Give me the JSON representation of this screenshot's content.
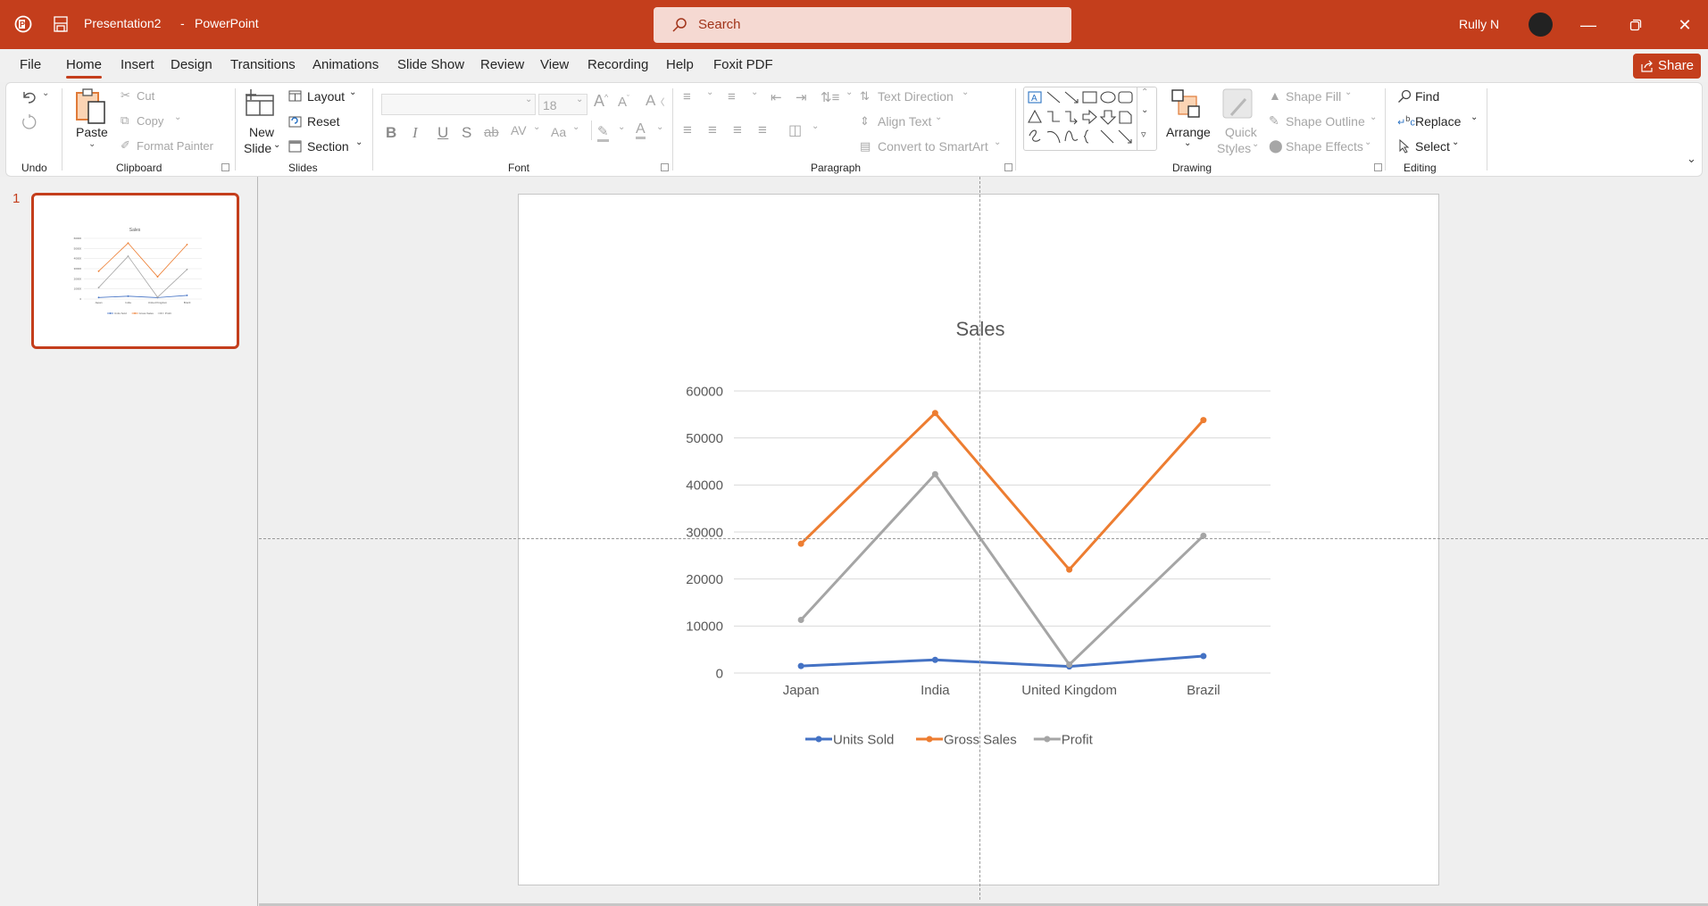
{
  "app": {
    "document_title": "Presentation2",
    "separator": "-",
    "app_name": "PowerPoint",
    "search_placeholder": "Search",
    "user_name": "Rully N",
    "accent_color": "#c43e1c"
  },
  "tabs": [
    {
      "label": "File",
      "active": false
    },
    {
      "label": "Home",
      "active": true
    },
    {
      "label": "Insert",
      "active": false
    },
    {
      "label": "Design",
      "active": false
    },
    {
      "label": "Transitions",
      "active": false
    },
    {
      "label": "Animations",
      "active": false
    },
    {
      "label": "Slide Show",
      "active": false
    },
    {
      "label": "Review",
      "active": false
    },
    {
      "label": "View",
      "active": false
    },
    {
      "label": "Recording",
      "active": false
    },
    {
      "label": "Help",
      "active": false
    },
    {
      "label": "Foxit PDF",
      "active": false
    }
  ],
  "share_label": "Share",
  "ribbon": {
    "undo": {
      "group": "Undo"
    },
    "clipboard": {
      "group": "Clipboard",
      "paste": "Paste",
      "cut": "Cut",
      "copy": "Copy",
      "format_painter": "Format Painter"
    },
    "slides": {
      "group": "Slides",
      "new_slide_line1": "New",
      "new_slide_line2": "Slide",
      "layout": "Layout",
      "reset": "Reset",
      "section": "Section"
    },
    "font": {
      "group": "Font",
      "font_name": "",
      "font_size": "18",
      "bold": "B",
      "italic": "I",
      "underline": "U",
      "shadow": "S",
      "strike": "ab",
      "spacing": "AV",
      "case": "Aa"
    },
    "paragraph": {
      "group": "Paragraph",
      "text_direction": "Text Direction",
      "align_text": "Align Text",
      "convert_smartart": "Convert to SmartArt"
    },
    "drawing": {
      "group": "Drawing",
      "arrange": "Arrange",
      "quick_styles_1": "Quick",
      "quick_styles_2": "Styles",
      "shape_fill": "Shape Fill",
      "shape_outline": "Shape Outline",
      "shape_effects": "Shape Effects"
    },
    "editing": {
      "group": "Editing",
      "find": "Find",
      "replace": "Replace",
      "select": "Select"
    }
  },
  "thumbnails": [
    {
      "number": "1",
      "selected": true
    }
  ],
  "chart_data": {
    "type": "line",
    "title": "Sales",
    "categories": [
      "Japan",
      "India",
      "United Kingdom",
      "Brazil"
    ],
    "series": [
      {
        "name": "Units Sold",
        "color": "#4472c4",
        "values": [
          1500,
          2800,
          1400,
          3600
        ]
      },
      {
        "name": "Gross Sales",
        "color": "#ed7d31",
        "values": [
          27500,
          55300,
          22000,
          53800
        ]
      },
      {
        "name": "Profit",
        "color": "#a5a5a5",
        "values": [
          11300,
          42300,
          1800,
          29200
        ]
      }
    ],
    "yticks": [
      "0",
      "10000",
      "20000",
      "30000",
      "40000",
      "50000",
      "60000"
    ],
    "ylim": [
      0,
      60000
    ],
    "xlabel": "",
    "ylabel": "",
    "grid": true,
    "legend": "bottom"
  }
}
